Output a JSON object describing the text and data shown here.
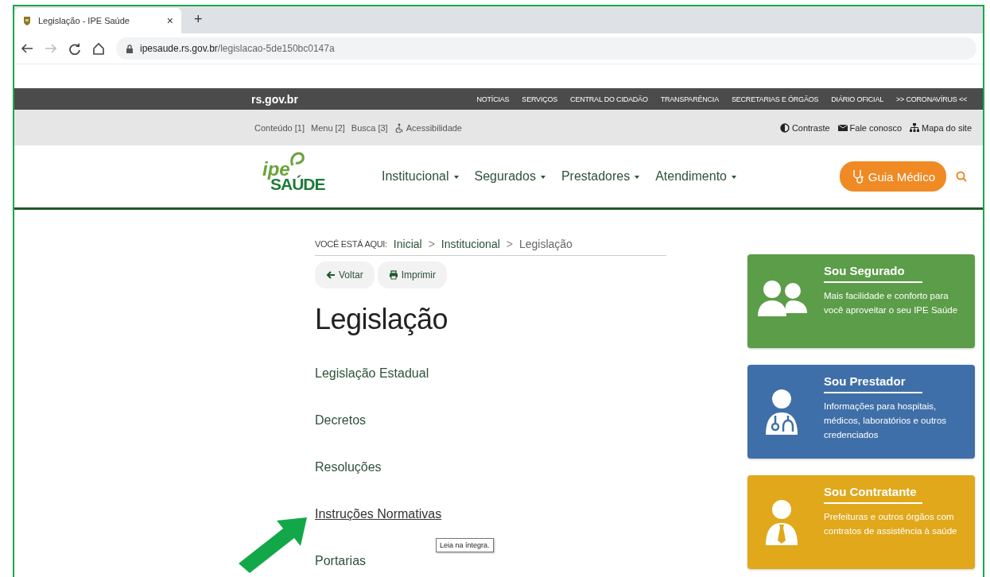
{
  "browser": {
    "tab_title": "Legislação - IPE Saúde",
    "tab_close": "×",
    "new_tab": "+",
    "url_host": "ipesaude.rs.gov.br",
    "url_path": "/legislacao-5de150bc0147a"
  },
  "gov_bar": {
    "brand": "rs.gov.br",
    "links": [
      "NOTÍCIAS",
      "SERVIÇOS",
      "CENTRAL DO CIDADÃO",
      "TRANSPARÊNCIA",
      "SECRETARIAS E ÓRGÃOS",
      "DIÁRIO OFICIAL",
      ">> CORONAVÍRUS <<"
    ]
  },
  "access_bar": {
    "left_links": [
      {
        "label": "Conteúdo [1]",
        "kind": "plain"
      },
      {
        "label": "Menu [2]",
        "kind": "plain"
      },
      {
        "label": "Busca [3]",
        "kind": "plain"
      },
      {
        "label": "Acessibilidade",
        "kind": "accessibility"
      }
    ],
    "right_links": [
      {
        "label": "Contraste",
        "kind": "contrast"
      },
      {
        "label": "Fale conosco",
        "kind": "mail"
      },
      {
        "label": "Mapa do site",
        "kind": "sitemap"
      }
    ]
  },
  "header": {
    "logo_top": "ipe",
    "logo_bottom": "SAÚDE",
    "nav": [
      "Institucional",
      "Segurados",
      "Prestadores",
      "Atendimento"
    ],
    "guide_button": "Guia Médico"
  },
  "breadcrumb": {
    "label": "VOCÊ ESTÁ AQUI:",
    "items": [
      {
        "text": "Inicial",
        "kind": "link"
      },
      {
        "text": ">",
        "kind": "separator"
      },
      {
        "text": "Institucional",
        "kind": "link"
      },
      {
        "text": ">",
        "kind": "separator"
      },
      {
        "text": "Legislação",
        "kind": "current"
      }
    ]
  },
  "actions": [
    {
      "label": "Voltar",
      "kind": "back"
    },
    {
      "label": "Imprimir",
      "kind": "print"
    }
  ],
  "title": "Legislação",
  "links": [
    {
      "label": "Legislação Estadual",
      "hovered": false
    },
    {
      "label": "Decretos",
      "hovered": false
    },
    {
      "label": "Resoluções",
      "hovered": false
    },
    {
      "label": "Instruções Normativas",
      "hovered": true
    },
    {
      "label": "Portarias",
      "hovered": false
    }
  ],
  "tooltip": "Leia na íntegra.",
  "cards": [
    {
      "kind": "insured",
      "title": "Sou Segurado",
      "text": "Mais facilidade e conforto para você aproveitar o seu IPE Saúde",
      "color": "#5b9d48"
    },
    {
      "kind": "provider",
      "title": "Sou Prestador",
      "text": "Informações para hospitais, médicos, laboratórios e outros credenciados",
      "color": "#3f6fa8"
    },
    {
      "kind": "contractor",
      "title": "Sou Contratante",
      "text": "Prefeituras e outros órgãos com contratos de assistência à saúde",
      "color": "#e0a81a"
    }
  ]
}
